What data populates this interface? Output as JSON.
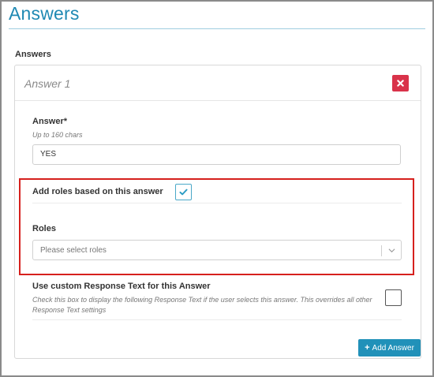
{
  "page": {
    "title": "Answers"
  },
  "answers_section": {
    "label": "Answers"
  },
  "answer_panel": {
    "title": "Answer 1",
    "delete_icon": "close-icon"
  },
  "answer_field": {
    "label": "Answer*",
    "hint": "Up to 160 chars",
    "value": "YES"
  },
  "roles_toggle": {
    "label": "Add roles based on this answer",
    "checked": true,
    "icon": "checkmark-icon"
  },
  "roles_field": {
    "label": "Roles",
    "placeholder": "Please select roles",
    "icon": "chevron-down-icon"
  },
  "custom_response": {
    "label": "Use custom Response Text for this Answer",
    "hint": "Check this box to display the following Response Text if the user selects this answer. This overrides all other Response Text settings",
    "checked": false
  },
  "add_answer_button": {
    "icon": "+",
    "label": "Add Answer"
  },
  "colors": {
    "accent": "#1f89b3",
    "danger": "#d9334a",
    "highlight": "#d6201d",
    "button": "#2191b9"
  }
}
